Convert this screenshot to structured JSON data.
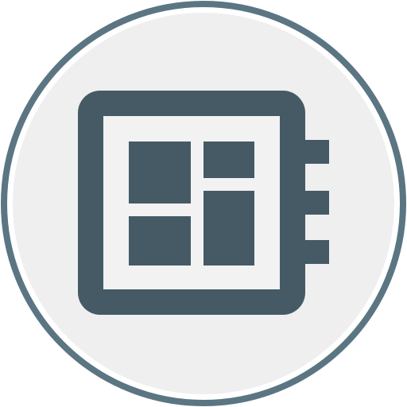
{
  "icon": {
    "name": "dashboard-layout-icon",
    "colors": {
      "ring": "#5B7583",
      "background": "#EFEFEF",
      "body": "#455A64",
      "panel": "#F2F2F2",
      "tile": "#455A64"
    }
  }
}
